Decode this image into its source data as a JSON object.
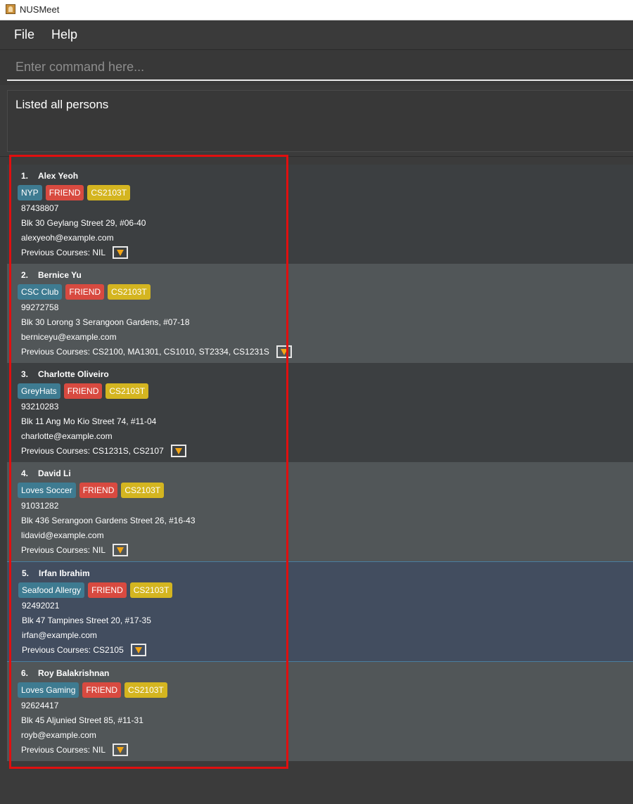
{
  "window": {
    "title": "NUSMeet"
  },
  "menu": {
    "file": "File",
    "help": "Help"
  },
  "command": {
    "placeholder": "Enter command here...",
    "value": ""
  },
  "result": {
    "message": "Listed all persons"
  },
  "colors": {
    "group_tag": "#3e7b91",
    "friend_tag": "#d84a40",
    "course_tag": "#d4b520",
    "dropdown_arrow": "#f2a516",
    "highlight": "#e00f0f"
  },
  "persons": [
    {
      "index": "1.",
      "name": "Alex Yeoh",
      "tags": [
        "NYP",
        "FRIEND",
        "CS2103T"
      ],
      "phone": "87438807",
      "address": "Blk 30 Geylang Street 29, #06-40",
      "email": "alexyeoh@example.com",
      "previous_courses": "Previous Courses: NIL"
    },
    {
      "index": "2.",
      "name": "Bernice Yu",
      "tags": [
        "CSC Club",
        "FRIEND",
        "CS2103T"
      ],
      "phone": "99272758",
      "address": "Blk 30 Lorong 3 Serangoon Gardens, #07-18",
      "email": "berniceyu@example.com",
      "previous_courses": "Previous Courses: CS2100, MA1301, CS1010, ST2334, CS1231S"
    },
    {
      "index": "3.",
      "name": "Charlotte Oliveiro",
      "tags": [
        "GreyHats",
        "FRIEND",
        "CS2103T"
      ],
      "phone": "93210283",
      "address": "Blk 11 Ang Mo Kio Street 74, #11-04",
      "email": "charlotte@example.com",
      "previous_courses": "Previous Courses: CS1231S, CS2107"
    },
    {
      "index": "4.",
      "name": "David Li",
      "tags": [
        "Loves Soccer",
        "FRIEND",
        "CS2103T"
      ],
      "phone": "91031282",
      "address": "Blk 436 Serangoon Gardens Street 26, #16-43",
      "email": "lidavid@example.com",
      "previous_courses": "Previous Courses: NIL"
    },
    {
      "index": "5.",
      "name": "Irfan Ibrahim",
      "tags": [
        "Seafood Allergy",
        "FRIEND",
        "CS2103T"
      ],
      "phone": "92492021",
      "address": "Blk 47 Tampines Street 20, #17-35",
      "email": "irfan@example.com",
      "previous_courses": "Previous Courses: CS2105"
    },
    {
      "index": "6.",
      "name": "Roy Balakrishnan",
      "tags": [
        "Loves Gaming",
        "FRIEND",
        "CS2103T"
      ],
      "phone": "92624417",
      "address": "Blk 45 Aljunied Street 85, #11-31",
      "email": "royb@example.com",
      "previous_courses": "Previous Courses: NIL"
    }
  ]
}
